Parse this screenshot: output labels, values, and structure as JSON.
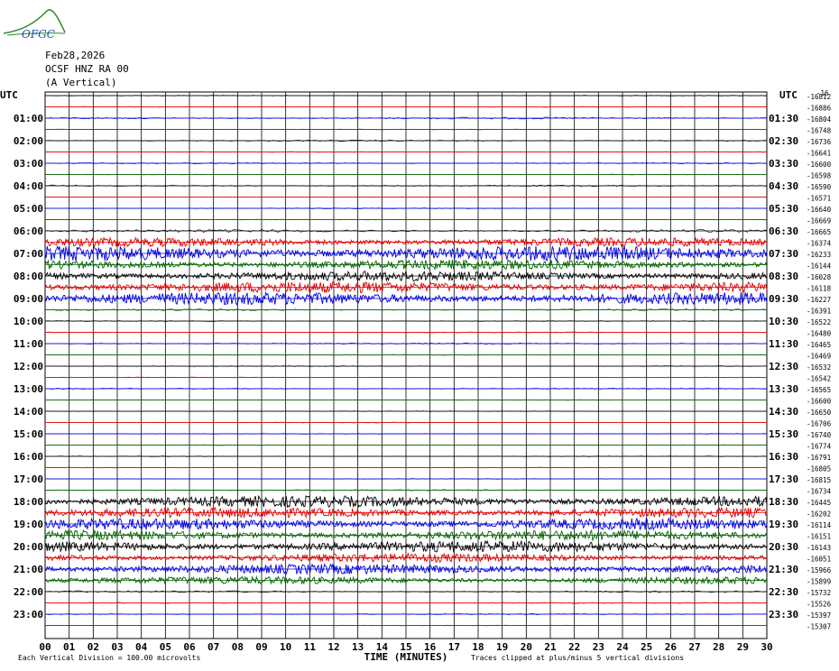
{
  "logo_text": "OFGC",
  "header": {
    "date": "Feb28,2026",
    "station": "OCSF HNZ RA 00",
    "component": "(A Vertical)"
  },
  "chart_data": {
    "type": "line",
    "title": "Feb28,2026 OCSF HNZ RA 00 (A Vertical)",
    "xlabel": "TIME (MINUTES)",
    "x_ticks": [
      "00",
      "01",
      "02",
      "03",
      "04",
      "05",
      "06",
      "07",
      "08",
      "09",
      "10",
      "11",
      "12",
      "13",
      "14",
      "15",
      "16",
      "17",
      "18",
      "19",
      "20",
      "21",
      "22",
      "23",
      "24",
      "25",
      "26",
      "27",
      "28",
      "29",
      "30"
    ],
    "xlim": [
      0,
      30
    ],
    "left_axis_title": "UTC",
    "right_axis_title": "UTC",
    "right_top_label": "-16",
    "left_hour_labels": [
      "01:00",
      "02:00",
      "03:00",
      "04:00",
      "05:00",
      "06:00",
      "07:00",
      "08:00",
      "09:00",
      "10:00",
      "11:00",
      "12:00",
      "13:00",
      "14:00",
      "15:00",
      "16:00",
      "17:00",
      "18:00",
      "19:00",
      "20:00",
      "21:00",
      "22:00",
      "23:00"
    ],
    "right_hour_labels": [
      "01:30",
      "02:30",
      "03:30",
      "04:30",
      "05:30",
      "06:30",
      "07:30",
      "08:30",
      "09:30",
      "10:30",
      "11:30",
      "12:30",
      "13:30",
      "14:30",
      "15:30",
      "16:30",
      "17:30",
      "18:30",
      "19:30",
      "20:30",
      "21:30",
      "22:30",
      "23:30"
    ],
    "trace_offsets": [
      "-16812",
      "-16886",
      "-16804",
      "-16748",
      "-16736",
      "-16641",
      "-16600",
      "-16598",
      "-16590",
      "-16571",
      "-16640",
      "-16669",
      "-16665",
      "-16374",
      "-16233",
      "-16144",
      "-16028",
      "-16118",
      "-16227",
      "-16391",
      "-16522",
      "-16480",
      "-16465",
      "-16469",
      "-16532",
      "-16542",
      "-16565",
      "-16600",
      "-16650",
      "-16706",
      "-16740",
      "-16774",
      "-16791",
      "-16805",
      "-16815",
      "-16734",
      "-16445",
      "-16202",
      "-16114",
      "-16151",
      "-16143",
      "-16051",
      "-15966",
      "-15899",
      "-15732",
      "-15526",
      "-15397",
      "-15307"
    ],
    "trace_colors": [
      "#000000",
      "#e00000",
      "#0000e0",
      "#006000"
    ],
    "trace_amplitudes": [
      0.35,
      0.3,
      0.8,
      0.3,
      0.6,
      0.35,
      0.5,
      0.3,
      0.6,
      0.3,
      0.35,
      0.3,
      1.2,
      3.5,
      6.0,
      4.0,
      4.0,
      4.5,
      5.0,
      0.8,
      0.4,
      0.35,
      0.6,
      0.35,
      0.35,
      0.3,
      0.5,
      0.3,
      0.3,
      0.3,
      0.3,
      0.3,
      0.3,
      0.3,
      0.3,
      0.6,
      4.5,
      4.0,
      4.5,
      4.0,
      4.5,
      3.5,
      4.0,
      3.0,
      0.8,
      0.5,
      0.5,
      0.3
    ],
    "grid": true,
    "footer_left": "Each Vertical Division =  100.00 microvolts",
    "footer_right": "Traces clipped at plus/minus 5 vertical divisions"
  }
}
